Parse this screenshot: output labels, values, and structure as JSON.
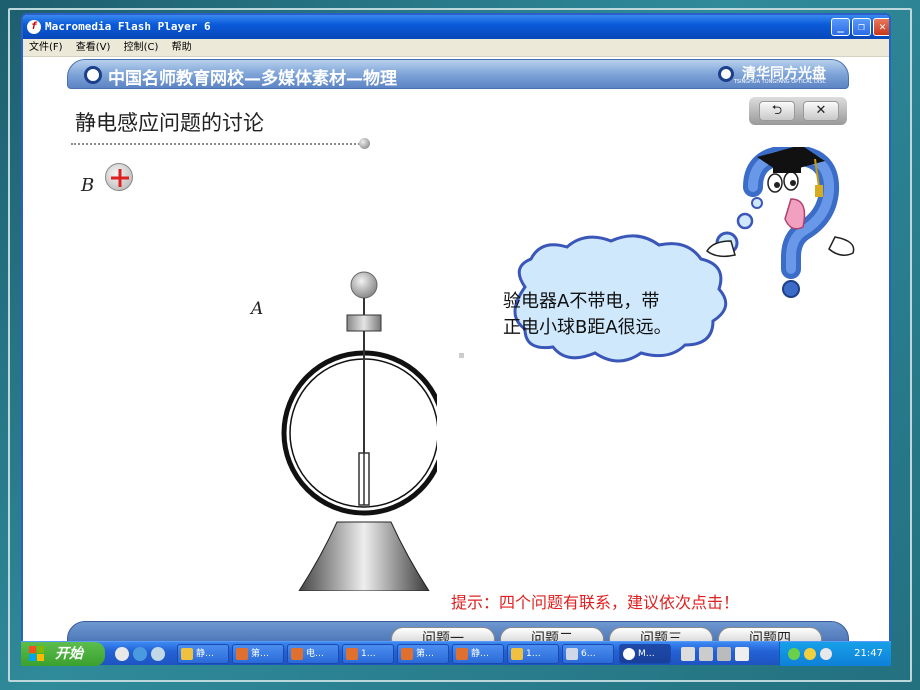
{
  "window": {
    "title": "Macromedia Flash Player 6",
    "minimize_label": "_",
    "restore_label": "❐",
    "close_label": "✕"
  },
  "menu": [
    "文件(F)",
    "查看(V)",
    "控制(C)",
    "帮助"
  ],
  "banner": {
    "title": "中国名师教育网校—多媒体素材—物理",
    "publisher": "清华同方光盘",
    "publisher_sub": "TSINGHUA TONGFANG OPTICAL DISC"
  },
  "page": {
    "title": "静电感应问题的讨论"
  },
  "nav": {
    "back_label": "⮌",
    "close_label": "✕"
  },
  "labels": {
    "b": "B",
    "a": "A"
  },
  "bubble": {
    "line1": "验电器A不带电，带",
    "line2": "正电小球B距A很远。"
  },
  "hint": "提示：四个问题有联系，建议依次点击！",
  "questions": [
    "问题一",
    "问题二",
    "问题三",
    "问题四"
  ],
  "taskbar": {
    "start_label": "开始",
    "items": [
      "静…",
      "第…",
      "电…",
      "1…",
      "第…",
      "静…",
      "1…",
      "6…",
      "M…"
    ],
    "clock": "21:47"
  },
  "colors": {
    "accent": "#4c76b8",
    "hint": "#e02020",
    "charge": "#e02020"
  }
}
